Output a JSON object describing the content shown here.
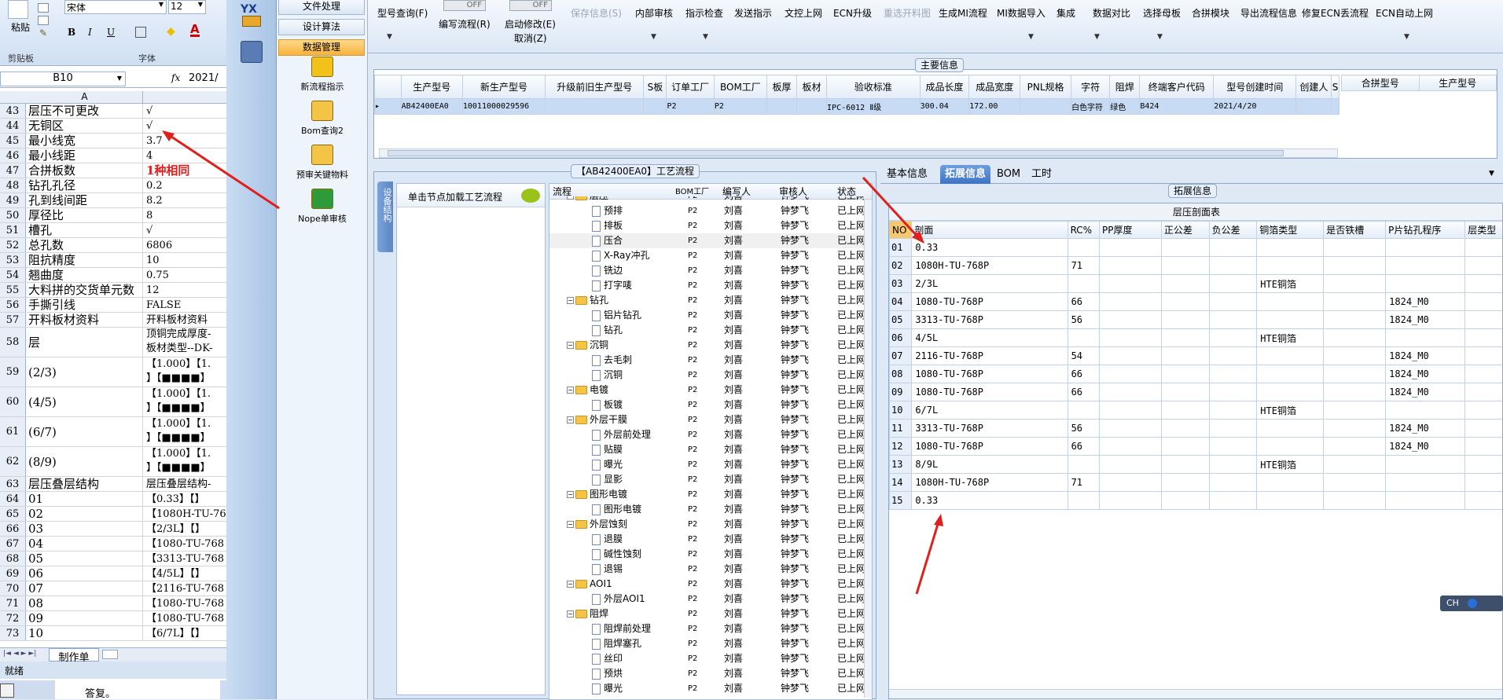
{
  "excel": {
    "font_name": "宋体",
    "font_size": "12",
    "paste": "粘贴",
    "clipboard": "剪贴板",
    "font_group": "字体",
    "cell_ref": "B10",
    "fx": "fx",
    "formula": "2021/",
    "col_a": "A",
    "rows": [
      {
        "n": "43",
        "a": "层压不可更改",
        "b": "√"
      },
      {
        "n": "44",
        "a": "无铜区",
        "b": "√"
      },
      {
        "n": "45",
        "a": "最小线宽",
        "b": "3.7"
      },
      {
        "n": "46",
        "a": "最小线距",
        "b": "4"
      },
      {
        "n": "47",
        "a": "合拼板数",
        "b": "1种相同"
      },
      {
        "n": "48",
        "a": "钻孔孔径",
        "b": "0.2"
      },
      {
        "n": "49",
        "a": "孔到线间距",
        "b": "8.2"
      },
      {
        "n": "50",
        "a": "厚径比",
        "b": "8"
      },
      {
        "n": "51",
        "a": "槽孔",
        "b": "√"
      },
      {
        "n": "52",
        "a": "总孔数",
        "b": "6806"
      },
      {
        "n": "53",
        "a": "阻抗精度",
        "b": "10"
      },
      {
        "n": "54",
        "a": "翘曲度",
        "b": "0.75"
      },
      {
        "n": "55",
        "a": "大料拼的交货单元数",
        "b": "12"
      },
      {
        "n": "56",
        "a": "手撕引线",
        "b": "FALSE"
      },
      {
        "n": "57",
        "a": "开料板材资料",
        "b": "开料板材资料"
      },
      {
        "n": "58",
        "a": "层",
        "b": "顶铜完成厚度-\n板材类型--DK-"
      },
      {
        "n": "59",
        "a": "(2/3)",
        "b": "【1.000】【1.\n】【■■■■】"
      },
      {
        "n": "60",
        "a": "(4/5)",
        "b": "【1.000】【1.\n】【■■■■】"
      },
      {
        "n": "61",
        "a": "(6/7)",
        "b": "【1.000】【1.\n】【■■■■】"
      },
      {
        "n": "62",
        "a": "(8/9)",
        "b": "【1.000】【1.\n】【■■■■】"
      },
      {
        "n": "63",
        "a": "层压叠层结构",
        "b": "层压叠层结构-"
      },
      {
        "n": "64",
        "a": "01",
        "b": "【0.33】【】"
      },
      {
        "n": "65",
        "a": "02",
        "b": "【1080H-TU-76"
      },
      {
        "n": "66",
        "a": "03",
        "b": "【2/3L】【】"
      },
      {
        "n": "67",
        "a": "04",
        "b": "【1080-TU-768"
      },
      {
        "n": "68",
        "a": "05",
        "b": "【3313-TU-768"
      },
      {
        "n": "69",
        "a": "06",
        "b": "【4/5L】【】"
      },
      {
        "n": "70",
        "a": "07",
        "b": "【2116-TU-768"
      },
      {
        "n": "71",
        "a": "08",
        "b": "【1080-TU-768"
      },
      {
        "n": "72",
        "a": "09",
        "b": "【1080-TU-768"
      },
      {
        "n": "73",
        "a": "10",
        "b": "【6/7L】【】"
      }
    ],
    "sheet_tab": "制作单",
    "status": "就绪",
    "doc_text": "答复。"
  },
  "nav": {
    "brand": "YX",
    "buttons": [
      "文件处理",
      "设计算法",
      "数据管理"
    ],
    "tools": [
      "新流程指示",
      "Bom查询2",
      "预审关键物料",
      "Nope单审核"
    ]
  },
  "toolbar": {
    "items": [
      "型号查询(F)",
      "编写流程(R)",
      "启动修改(E)",
      "保存信息(S)",
      "内部审核",
      "指示检查",
      "发送指示",
      "文控上网",
      "ECN升级",
      "重选开料图",
      "生成MI流程",
      "MI数据导入",
      "集成",
      "数据对比",
      "选择母板",
      "合拼模块",
      "导出流程信息",
      "修复ECN丢流程",
      "ECN自动上网"
    ],
    "cancel": "取消(Z)",
    "off": "OFF"
  },
  "main_info": {
    "title": "主要信息",
    "headers": [
      "生产型号",
      "新生产型号",
      "升级前旧生产型号",
      "S板",
      "订单工厂",
      "BOM工厂",
      "板厚",
      "板材",
      "验收标准",
      "成品长度",
      "成品宽度",
      "PNL规格",
      "字符",
      "阻焊",
      "终端客户代码",
      "型号创建时间",
      "创建人",
      "S"
    ],
    "row": [
      "AB42400EA0",
      "10011000029596",
      "",
      "",
      "P2",
      "P2",
      "",
      "",
      "IPC-6012 Ⅱ级",
      "300.04",
      "172.00",
      "",
      "白色字符",
      "绿色",
      "B424",
      "2021/4/20",
      "",
      ""
    ],
    "right_headers": [
      "合拼型号",
      "生产型号"
    ]
  },
  "process": {
    "title": "【AB42400EA0】工艺流程",
    "side_tab": "设备结构",
    "hint": "单击节点加载工艺流程",
    "headers": [
      "流程",
      "BOM工厂",
      "编写人",
      "审核人",
      "状态"
    ],
    "rows": [
      {
        "name": "层压",
        "lvl": 0,
        "f": "P2",
        "w": "刘喜",
        "r": "钟梦飞",
        "s": "已上网"
      },
      {
        "name": "预排",
        "lvl": 1,
        "f": "P2",
        "w": "刘喜",
        "r": "钟梦飞",
        "s": "已上网"
      },
      {
        "name": "排板",
        "lvl": 1,
        "f": "P2",
        "w": "刘喜",
        "r": "钟梦飞",
        "s": "已上网"
      },
      {
        "name": "压合",
        "lvl": 1,
        "f": "P2",
        "w": "刘喜",
        "r": "钟梦飞",
        "s": "已上网"
      },
      {
        "name": "X-Ray冲孔",
        "lvl": 1,
        "f": "P2",
        "w": "刘喜",
        "r": "钟梦飞",
        "s": "已上网"
      },
      {
        "name": "铣边",
        "lvl": 1,
        "f": "P2",
        "w": "刘喜",
        "r": "钟梦飞",
        "s": "已上网"
      },
      {
        "name": "打字唛",
        "lvl": 1,
        "f": "P2",
        "w": "刘喜",
        "r": "钟梦飞",
        "s": "已上网"
      },
      {
        "name": "钻孔",
        "lvl": 0,
        "f": "P2",
        "w": "刘喜",
        "r": "钟梦飞",
        "s": "已上网"
      },
      {
        "name": "铝片钻孔",
        "lvl": 1,
        "f": "P2",
        "w": "刘喜",
        "r": "钟梦飞",
        "s": "已上网"
      },
      {
        "name": "钻孔",
        "lvl": 1,
        "f": "P2",
        "w": "刘喜",
        "r": "钟梦飞",
        "s": "已上网"
      },
      {
        "name": "沉铜",
        "lvl": 0,
        "f": "P2",
        "w": "刘喜",
        "r": "钟梦飞",
        "s": "已上网"
      },
      {
        "name": "去毛刺",
        "lvl": 1,
        "f": "P2",
        "w": "刘喜",
        "r": "钟梦飞",
        "s": "已上网"
      },
      {
        "name": "沉铜",
        "lvl": 1,
        "f": "P2",
        "w": "刘喜",
        "r": "钟梦飞",
        "s": "已上网"
      },
      {
        "name": "电镀",
        "lvl": 0,
        "f": "P2",
        "w": "刘喜",
        "r": "钟梦飞",
        "s": "已上网"
      },
      {
        "name": "板镀",
        "lvl": 1,
        "f": "P2",
        "w": "刘喜",
        "r": "钟梦飞",
        "s": "已上网"
      },
      {
        "name": "外层干膜",
        "lvl": 0,
        "f": "P2",
        "w": "刘喜",
        "r": "钟梦飞",
        "s": "已上网"
      },
      {
        "name": "外层前处理",
        "lvl": 1,
        "f": "P2",
        "w": "刘喜",
        "r": "钟梦飞",
        "s": "已上网"
      },
      {
        "name": "贴膜",
        "lvl": 1,
        "f": "P2",
        "w": "刘喜",
        "r": "钟梦飞",
        "s": "已上网"
      },
      {
        "name": "曝光",
        "lvl": 1,
        "f": "P2",
        "w": "刘喜",
        "r": "钟梦飞",
        "s": "已上网"
      },
      {
        "name": "显影",
        "lvl": 1,
        "f": "P2",
        "w": "刘喜",
        "r": "钟梦飞",
        "s": "已上网"
      },
      {
        "name": "图形电镀",
        "lvl": 0,
        "f": "P2",
        "w": "刘喜",
        "r": "钟梦飞",
        "s": "已上网"
      },
      {
        "name": "图形电镀",
        "lvl": 1,
        "f": "P2",
        "w": "刘喜",
        "r": "钟梦飞",
        "s": "已上网"
      },
      {
        "name": "外层蚀刻",
        "lvl": 0,
        "f": "P2",
        "w": "刘喜",
        "r": "钟梦飞",
        "s": "已上网"
      },
      {
        "name": "退膜",
        "lvl": 1,
        "f": "P2",
        "w": "刘喜",
        "r": "钟梦飞",
        "s": "已上网"
      },
      {
        "name": "碱性蚀刻",
        "lvl": 1,
        "f": "P2",
        "w": "刘喜",
        "r": "钟梦飞",
        "s": "已上网"
      },
      {
        "name": "退锡",
        "lvl": 1,
        "f": "P2",
        "w": "刘喜",
        "r": "钟梦飞",
        "s": "已上网"
      },
      {
        "name": "AOI1",
        "lvl": 0,
        "f": "P2",
        "w": "刘喜",
        "r": "钟梦飞",
        "s": "已上网"
      },
      {
        "name": "外层AOI1",
        "lvl": 1,
        "f": "P2",
        "w": "刘喜",
        "r": "钟梦飞",
        "s": "已上网"
      },
      {
        "name": "阻焊",
        "lvl": 0,
        "f": "P2",
        "w": "刘喜",
        "r": "钟梦飞",
        "s": "已上网"
      },
      {
        "name": "阻焊前处理",
        "lvl": 1,
        "f": "P2",
        "w": "刘喜",
        "r": "钟梦飞",
        "s": "已上网"
      },
      {
        "name": "阻焊塞孔",
        "lvl": 1,
        "f": "P2",
        "w": "刘喜",
        "r": "钟梦飞",
        "s": "已上网"
      },
      {
        "name": "丝印",
        "lvl": 1,
        "f": "P2",
        "w": "刘喜",
        "r": "钟梦飞",
        "s": "已上网"
      },
      {
        "name": "预烘",
        "lvl": 1,
        "f": "P2",
        "w": "刘喜",
        "r": "钟梦飞",
        "s": "已上网"
      },
      {
        "name": "曝光",
        "lvl": 1,
        "f": "P2",
        "w": "刘喜",
        "r": "钟梦飞",
        "s": "已上网"
      }
    ]
  },
  "detail": {
    "tabs": [
      "基本信息",
      "拓展信息",
      "BOM",
      "工时"
    ],
    "group_title": "拓展信息",
    "table_title": "层压剖面表",
    "headers": [
      "NO",
      "剖面",
      "RC%",
      "PP厚度",
      "正公差",
      "负公差",
      "铜箔类型",
      "是否铁槽",
      "P片钻孔程序",
      "层类型"
    ],
    "rows": [
      [
        "01",
        "0.33",
        "",
        "",
        "",
        "",
        "",
        "",
        "",
        ""
      ],
      [
        "02",
        "1080H-TU-768P",
        "71",
        "",
        "",
        "",
        "",
        "",
        "",
        ""
      ],
      [
        "03",
        "2/3L",
        "",
        "",
        "",
        "",
        "HTE铜箔",
        "",
        "",
        ""
      ],
      [
        "04",
        "1080-TU-768P",
        "66",
        "",
        "",
        "",
        "",
        "",
        "1824_M0",
        ""
      ],
      [
        "05",
        "3313-TU-768P",
        "56",
        "",
        "",
        "",
        "",
        "",
        "1824_M0",
        ""
      ],
      [
        "06",
        "4/5L",
        "",
        "",
        "",
        "",
        "HTE铜箔",
        "",
        "",
        ""
      ],
      [
        "07",
        "2116-TU-768P",
        "54",
        "",
        "",
        "",
        "",
        "",
        "1824_M0",
        ""
      ],
      [
        "08",
        "1080-TU-768P",
        "66",
        "",
        "",
        "",
        "",
        "",
        "1824_M0",
        ""
      ],
      [
        "09",
        "1080-TU-768P",
        "66",
        "",
        "",
        "",
        "",
        "",
        "1824_M0",
        ""
      ],
      [
        "10",
        "6/7L",
        "",
        "",
        "",
        "",
        "HTE铜箔",
        "",
        "",
        ""
      ],
      [
        "11",
        "3313-TU-768P",
        "56",
        "",
        "",
        "",
        "",
        "",
        "1824_M0",
        ""
      ],
      [
        "12",
        "1080-TU-768P",
        "66",
        "",
        "",
        "",
        "",
        "",
        "1824_M0",
        ""
      ],
      [
        "13",
        "8/9L",
        "",
        "",
        "",
        "",
        "HTE铜箔",
        "",
        "",
        ""
      ],
      [
        "14",
        "1080H-TU-768P",
        "71",
        "",
        "",
        "",
        "",
        "",
        "",
        ""
      ],
      [
        "15",
        "0.33",
        "",
        "",
        "",
        "",
        "",
        "",
        "",
        ""
      ]
    ]
  },
  "ime": {
    "label": "CH"
  }
}
